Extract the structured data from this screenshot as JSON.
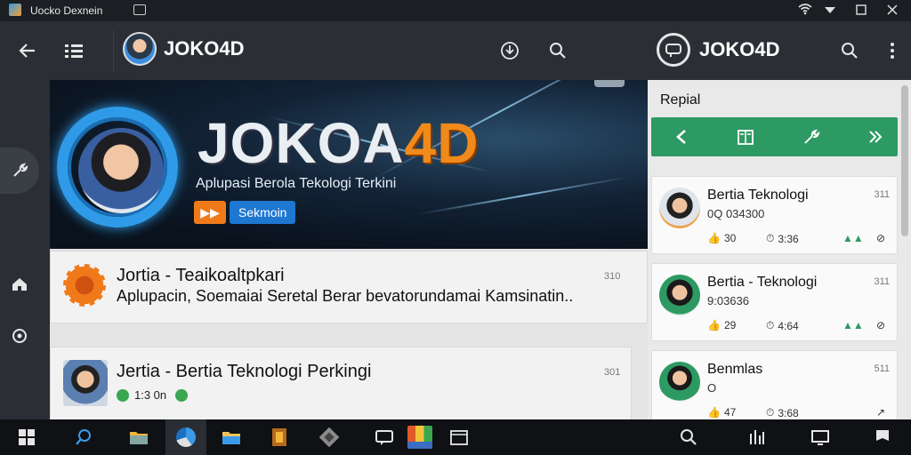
{
  "window": {
    "title": "Uocko Dexnein"
  },
  "appbar_left": {
    "brand": "JOKO4D"
  },
  "appbar_right": {
    "brand": "JOKO4D"
  },
  "hero": {
    "title_white": "JOKOA",
    "title_orange": "4D",
    "subtitle": "Aplupasi Berola Tekologi Terkini",
    "play_label": "▶▶",
    "badge_label": "Sekmoin"
  },
  "feed": [
    {
      "title": "Jortia - Teaikoaltpkari",
      "subtitle": "Aplupacin, Soemaiai Seretal Berar bevatorundamai Kamsinatin..",
      "num": "310"
    },
    {
      "title": "Jertia - Bertia Teknologi Perkingi",
      "chip": "1:3 0n",
      "num": "301"
    }
  ],
  "panel": {
    "title": "Repial",
    "cards": [
      {
        "title": "Bertia Teknologi",
        "subtitle": "0Q 034300",
        "num": "311",
        "stat1": "30",
        "stat2": "3:36",
        "accent": "#2e9a63"
      },
      {
        "title": "Bertia - Teknologi",
        "subtitle": "9:03636",
        "num": "311",
        "stat1": "29",
        "stat2": "4:64",
        "accent": "#2e9a63"
      },
      {
        "title": "Benmlas",
        "subtitle": "O",
        "num": "511",
        "stat1": "47",
        "stat2": "3:68",
        "accent": "#2e9a63"
      }
    ]
  },
  "icons": {
    "back": "arrow-left-icon",
    "menu": "menu-icon",
    "download": "download-icon",
    "search": "search-icon",
    "more": "more-vertical-icon",
    "wrench": "wrench-icon",
    "home": "home-icon",
    "refresh": "refresh-icon"
  },
  "colors": {
    "appbar": "#2b2f35",
    "accent_green": "#2e9a63",
    "accent_orange": "#f08a1a",
    "accent_blue": "#2f9be8"
  }
}
